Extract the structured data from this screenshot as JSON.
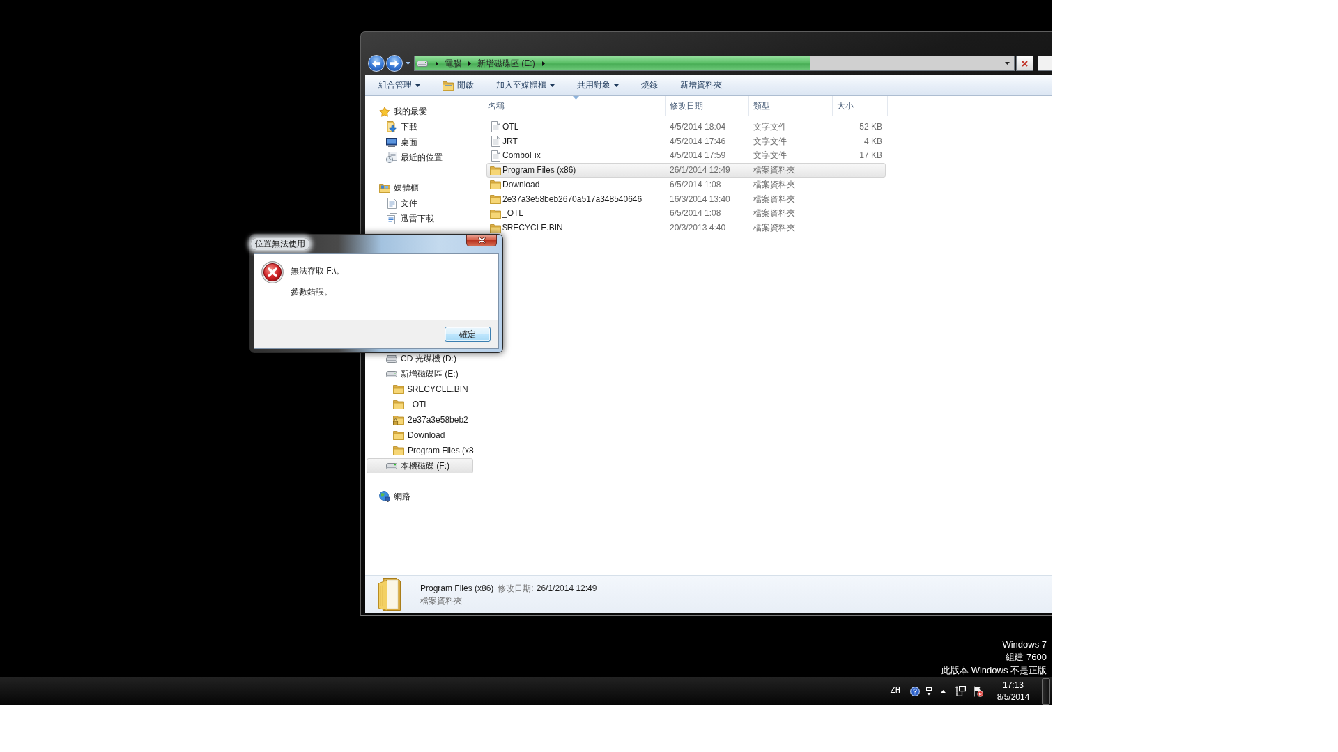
{
  "explorer": {
    "address_bar": {
      "crumbs": [
        "電腦",
        "新增磁碟區 (E:)"
      ],
      "level": 0.66
    },
    "commands": [
      {
        "label": "組合管理",
        "kind": "menu"
      },
      {
        "label": "開啟",
        "kind": "open"
      },
      {
        "label": "加入至媒體櫃",
        "kind": "menu"
      },
      {
        "label": "共用對象",
        "kind": "menu"
      },
      {
        "label": "燒錄",
        "kind": "plain"
      },
      {
        "label": "新增資料夾",
        "kind": "plain"
      }
    ],
    "sidebar": {
      "items": [
        {
          "label": "我的最愛",
          "kind": "star",
          "selected": false,
          "children": [
            {
              "label": "下載",
              "kind": "downloads",
              "selected": false
            },
            {
              "label": "桌面",
              "kind": "desktop",
              "selected": false
            },
            {
              "label": "最近的位置",
              "kind": "recent",
              "selected": false
            }
          ]
        },
        {
          "label": "媒體櫃",
          "kind": "library",
          "selected": false,
          "children": [
            {
              "label": "文件",
              "kind": "document",
              "selected": false
            },
            {
              "label": "迅雷下載",
              "kind": "thunder",
              "selected": false
            }
          ]
        },
        {
          "children": [
            {
              "label": "CD 光碟機 (D:)",
              "kind": "optical",
              "selected": false
            },
            {
              "label": "新增磁碟區 (E:)",
              "kind": "disk",
              "selected": false,
              "children": [
                {
                  "label": "$RECYCLE.BIN",
                  "kind": "folder",
                  "selected": false
                },
                {
                  "label": "_OTL",
                  "kind": "folder",
                  "selected": false
                },
                {
                  "label": "2e37a3e58beb2",
                  "kind": "locked",
                  "selected": false
                },
                {
                  "label": "Download",
                  "kind": "folder",
                  "selected": false
                },
                {
                  "label": "Program Files (x8",
                  "kind": "folder",
                  "selected": false
                }
              ]
            },
            {
              "label": "本機磁碟 (F:)",
              "kind": "disk",
              "selected": true
            }
          ]
        },
        {
          "label": "網路",
          "kind": "network",
          "selected": false
        }
      ]
    },
    "columns": [
      {
        "label": "名稱",
        "sorted": true
      },
      {
        "label": "修改日期",
        "sorted": false
      },
      {
        "label": "類型",
        "sorted": false
      },
      {
        "label": "大小",
        "sorted": false
      }
    ],
    "files": [
      {
        "name": "OTL",
        "kind": "textfile",
        "modified": "4/5/2014 18:04",
        "type": "文字文件",
        "size": "52 KB",
        "selected": false
      },
      {
        "name": "JRT",
        "kind": "textfile",
        "modified": "4/5/2014 17:46",
        "type": "文字文件",
        "size": "4 KB",
        "selected": false
      },
      {
        "name": "ComboFix",
        "kind": "textfile",
        "modified": "4/5/2014 17:59",
        "type": "文字文件",
        "size": "17 KB",
        "selected": false
      },
      {
        "name": "Program Files (x86)",
        "kind": "folder",
        "modified": "26/1/2014 12:49",
        "type": "檔案資料夾",
        "selected": true
      },
      {
        "name": "Download",
        "kind": "folder",
        "modified": "6/5/2014 1:08",
        "type": "檔案資料夾",
        "selected": false
      },
      {
        "name": "2e37a3e58beb2670a517a348540646",
        "kind": "folder",
        "modified": "16/3/2014 13:40",
        "type": "檔案資料夾",
        "selected": false
      },
      {
        "name": "_OTL",
        "kind": "folder",
        "modified": "6/5/2014 1:08",
        "type": "檔案資料夾",
        "selected": false
      },
      {
        "name": "$RECYCLE.BIN",
        "kind": "folder",
        "modified": "20/3/2013 4:40",
        "type": "檔案資料夾",
        "selected": false
      }
    ],
    "details": {
      "name": "Program Files (x86)",
      "modified_label": "修改日期:",
      "modified": "26/1/2014 12:49",
      "type": "檔案資料夾"
    }
  },
  "dialog": {
    "title": "位置無法使用",
    "lines": [
      "無法存取 F:\\。",
      "參數錯誤。"
    ],
    "button": "確定"
  },
  "desktop_text": [
    "Windows 7",
    "組建 7600",
    "此版本 Windows 不是正版"
  ],
  "taskbar": {
    "language": "ZH",
    "time": "17:13",
    "date": "8/5/2014"
  }
}
